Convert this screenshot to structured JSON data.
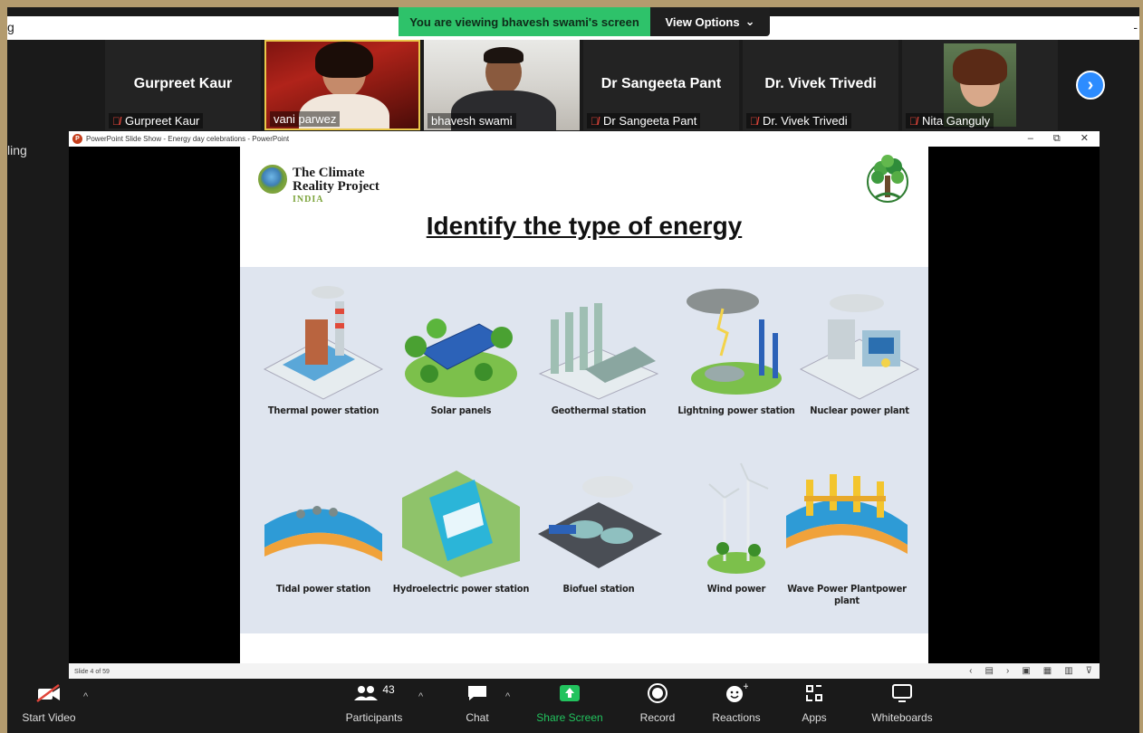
{
  "window": {
    "left_fragment": "g",
    "right_fragment": "-",
    "side_fragment": "ling"
  },
  "banner": {
    "viewing_text": "You are viewing bhavesh swami's screen",
    "view_options": "View Options",
    "caret": "⌄"
  },
  "gallery": [
    {
      "name": "Gurpreet Kaur",
      "label": "Gurpreet Kaur",
      "video": false,
      "muted": true
    },
    {
      "name": "vani parwez",
      "label": "vani parwez",
      "video": true,
      "muted": false
    },
    {
      "name": "bhavesh swami",
      "label": "bhavesh swami",
      "video": true,
      "muted": false
    },
    {
      "name": "Dr Sangeeta Pant",
      "label": "Dr Sangeeta Pant",
      "video": false,
      "muted": true
    },
    {
      "name": "Dr. Vivek Trivedi",
      "label": "Dr. Vivek Trivedi",
      "video": false,
      "muted": true
    },
    {
      "name": "Nita Ganguly",
      "label": "Nita Ganguly",
      "video": true,
      "muted": true
    }
  ],
  "next_arrow": "›",
  "ppt": {
    "title": "PowerPoint Slide Show  -  Energy day celebrations - PowerPoint",
    "logo_letter": "P",
    "win_min": "–",
    "win_restore": "⧉",
    "win_close": "✕",
    "slide_counter": "Slide 4 of 59",
    "footer_controls": [
      "‹",
      "▤",
      "›",
      "▣",
      "▦",
      "▥",
      "⊽"
    ]
  },
  "slide": {
    "logo_line1": "The Climate",
    "logo_line2": "Reality Project",
    "logo_india": "INDIA",
    "title": "Identify the type of energy",
    "items": [
      {
        "caption": "Thermal power station"
      },
      {
        "caption": "Solar panels"
      },
      {
        "caption": "Geothermal station"
      },
      {
        "caption": "Lightning power station"
      },
      {
        "caption": "Nuclear power plant"
      },
      {
        "caption": "Tidal power station"
      },
      {
        "caption": "Hydroelectric power station"
      },
      {
        "caption": "Biofuel station"
      },
      {
        "caption": "Wind power"
      },
      {
        "caption": "Wave Power Plantpower plant"
      }
    ]
  },
  "toolbar": {
    "start_video": "Start Video",
    "participants": "Participants",
    "participants_count": "43",
    "chat": "Chat",
    "share_screen": "Share Screen",
    "record": "Record",
    "reactions": "Reactions",
    "apps": "Apps",
    "whiteboards": "Whiteboards",
    "caret": "^"
  },
  "colors": {
    "accent_green": "#22c35e",
    "zoom_blue": "#2d8cff",
    "muted_red": "#e0453a",
    "frame": "#b39b6e"
  }
}
